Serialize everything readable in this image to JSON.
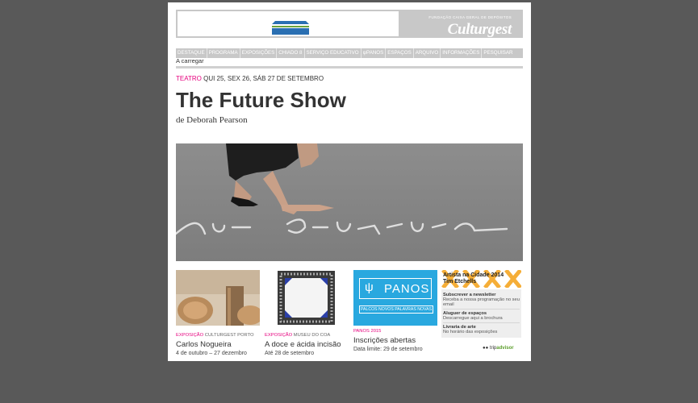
{
  "brand": {
    "kicker": "FUNDAÇÃO CAIXA GERAL DE DEPÓSITOS",
    "name": "Culturgest"
  },
  "nav": {
    "items": [
      "DESTAQUE",
      "PROGRAMA",
      "EXPOSIÇÕES",
      "CHIADO 8",
      "SERVIÇO EDUCATIVO",
      "PANOS",
      "ESPAÇOS",
      "ARQUIVO",
      "INFORMAÇÕES",
      "PESQUISAR"
    ]
  },
  "status": {
    "loading": "A carregar"
  },
  "event": {
    "category": "TEATRO",
    "dates": "QUI 25, SEX 26, SÁB 27 DE SETEMBRO",
    "title": "The Future Show",
    "byline": "de Deborah Pearson",
    "hero_text": "The Future"
  },
  "cards": [
    {
      "category": "EXPOSIÇÃO",
      "venue": "CULTURGEST PORTO",
      "title": "Carlos Nogueira",
      "date": "4 de outubro – 27 dezembro"
    },
    {
      "category": "EXPOSIÇÃO",
      "venue": "MUSEU DO COA",
      "title": "A doce e ácida incisão",
      "date": "Até 28 de setembro"
    },
    {
      "category": "PANOS 2015",
      "venue": "",
      "title": "Inscrições abertas",
      "date": "Data limite: 29 de setembro",
      "logo_word": "PANOS",
      "logo_tagline": "PALCOS NOVOS PALAVRAS NOVAS"
    }
  ],
  "sidepanel": {
    "title_line1": "Artista na Cidade 2014",
    "title_line2": "Tim Etchells",
    "items": [
      {
        "title": "Subscrever a newsletter",
        "desc": "Receba a nossa programação no seu email"
      },
      {
        "title": "Aluguer de espaços",
        "desc": "Descarregue aqui a brochura"
      },
      {
        "title": "Livraria de arte",
        "desc": "No horário das exposições"
      }
    ]
  },
  "footer": {
    "tripadvisor_prefix": "trip",
    "tripadvisor_suffix": "advisor"
  },
  "colors": {
    "accent": "#e6007e",
    "grey": "#c8c8c8",
    "panos_blue": "#29a8df",
    "background": "#595959"
  }
}
